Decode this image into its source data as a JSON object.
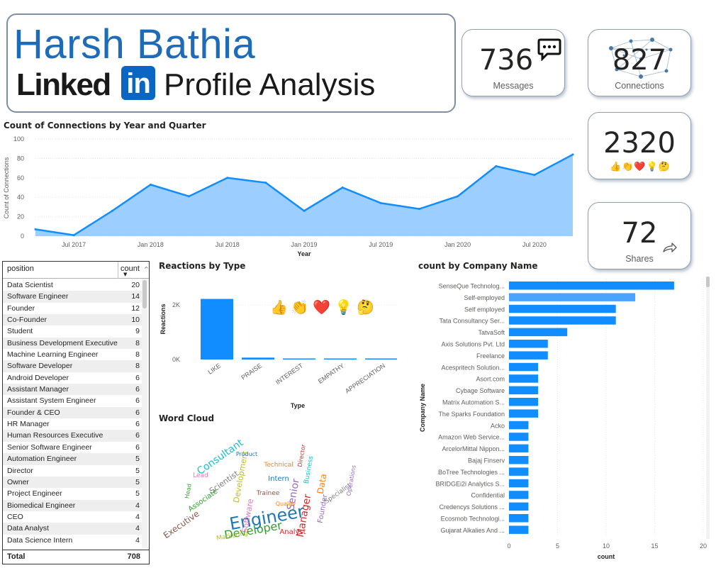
{
  "header": {
    "name": "Harsh Bathia",
    "linkedin_word": "Linked",
    "linkedin_in": "in",
    "subtitle": "Profile Analysis"
  },
  "kpis": {
    "messages": {
      "value": "736",
      "label": "Messages",
      "icon": "chat-bubble-icon"
    },
    "connections": {
      "value": "827",
      "label": "Connections",
      "icon": "network-icon"
    },
    "reactions": {
      "value": "2320",
      "icon": "reactions-icons"
    },
    "shares": {
      "value": "72",
      "label": "Shares",
      "icon": "share-arrow-icon"
    }
  },
  "connections_chart": {
    "title": "Count of Connections by Year and Quarter",
    "chart_data": {
      "type": "area",
      "x": [
        "2017 Q2",
        "2017 Q3",
        "2017 Q4",
        "2018 Q1",
        "2018 Q2",
        "2018 Q3",
        "2018 Q4",
        "2019 Q1",
        "2019 Q2",
        "2019 Q3",
        "2019 Q4",
        "2020 Q1",
        "2020 Q2",
        "2020 Q3",
        "2020 Q4"
      ],
      "values": [
        7,
        1,
        26,
        53,
        41,
        60,
        55,
        26,
        50,
        34,
        28,
        41,
        72,
        63,
        84
      ],
      "xlabel": "Year",
      "ylabel": "Count of Connections",
      "ylim": [
        0,
        100
      ],
      "yticks": [
        "0",
        "20",
        "40",
        "60",
        "80",
        "100"
      ],
      "xticks": [
        "Jul 2017",
        "Jan 2018",
        "Jul 2018",
        "Jan 2019",
        "Jul 2019",
        "Jan 2020",
        "Jul 2020"
      ],
      "color": "#118dff"
    }
  },
  "positions_table": {
    "headers": [
      "position",
      "count"
    ],
    "rows": [
      [
        "Data Scientist",
        "20"
      ],
      [
        "Software Engineer",
        "14"
      ],
      [
        "Founder",
        "12"
      ],
      [
        "Co-Founder",
        "10"
      ],
      [
        "Student",
        "9"
      ],
      [
        "Business Development Executive",
        "8"
      ],
      [
        "Machine Learning Engineer",
        "8"
      ],
      [
        "Software Developer",
        "8"
      ],
      [
        "Android Developer",
        "6"
      ],
      [
        "Assistant Manager",
        "6"
      ],
      [
        "Assistant System Engineer",
        "6"
      ],
      [
        "Founder & CEO",
        "6"
      ],
      [
        "HR Manager",
        "6"
      ],
      [
        "Human Resources Executive",
        "6"
      ],
      [
        "Senior Software Engineer",
        "6"
      ],
      [
        "Automation Engineer",
        "5"
      ],
      [
        "Director",
        "5"
      ],
      [
        "Owner",
        "5"
      ],
      [
        "Project Engineer",
        "5"
      ],
      [
        "Biomedical Engineer",
        "4"
      ],
      [
        "CEO",
        "4"
      ],
      [
        "Data Analyst",
        "4"
      ],
      [
        "Data Science Intern",
        "4"
      ]
    ],
    "total_label": "Total",
    "total_value": "708"
  },
  "reactions_chart": {
    "title": "Reactions by Type",
    "chart_data": {
      "type": "bar",
      "categories": [
        "LIKE",
        "PRAISE",
        "INTEREST",
        "EMPATHY",
        "APPRECIATION"
      ],
      "values": [
        2220,
        70,
        15,
        10,
        5
      ],
      "xlabel": "Type",
      "ylabel": "Reactions",
      "yticks": [
        "0K",
        "2K"
      ],
      "color": "#118dff"
    },
    "emojis": [
      "👍",
      "👏",
      "❤️",
      "💡",
      "🤔"
    ]
  },
  "wordcloud": {
    "title": "Word Cloud",
    "words": [
      "Engineer",
      "Manager",
      "Developer",
      "Senior",
      "Data",
      "Consultant",
      "Executive",
      "Software",
      "Development",
      "Scientist",
      "Intern",
      "Analyst",
      "Associate",
      "Founder",
      "Technical",
      "Business",
      "Trainee",
      "Lead",
      "Marketing",
      "Specialist",
      "Product",
      "Director",
      "Head",
      "Operations",
      "Quality"
    ]
  },
  "company_chart": {
    "title": "count by Company Name",
    "chart_data": {
      "type": "bar",
      "orientation": "horizontal",
      "categories": [
        "SenseQue Technolog...",
        "Self-employed",
        "Self employed",
        "Tata Consultancy Ser...",
        "TatvaSoft",
        "Axis Solutions Pvt. Ltd",
        "Freelance",
        "Acespritech Solution...",
        "Asort.com",
        "Cybage Software",
        "Matrix Automation S...",
        "The Sparks Foundation",
        "Acko",
        "Amazon Web Service...",
        "ArcelorMittal Nippon...",
        "Bajaj Finserv",
        "BoTree Technologies ...",
        "BRIDGEi2i Analytics S...",
        "Confidential",
        "Credencys Solutions ...",
        "Ecosmob Technologi...",
        "Gujarat Alkalies And ..."
      ],
      "values": [
        17,
        13,
        11,
        11,
        6,
        4,
        4,
        3,
        3,
        3,
        3,
        3,
        2,
        2,
        2,
        2,
        2,
        2,
        2,
        2,
        2,
        2
      ],
      "xlabel": "count",
      "ylabel": "Company Name",
      "xlim": [
        0,
        20
      ],
      "xticks": [
        "0",
        "5",
        "10",
        "15",
        "20"
      ],
      "color": "#118dff",
      "highlight_color": "#4aa3ff"
    }
  }
}
